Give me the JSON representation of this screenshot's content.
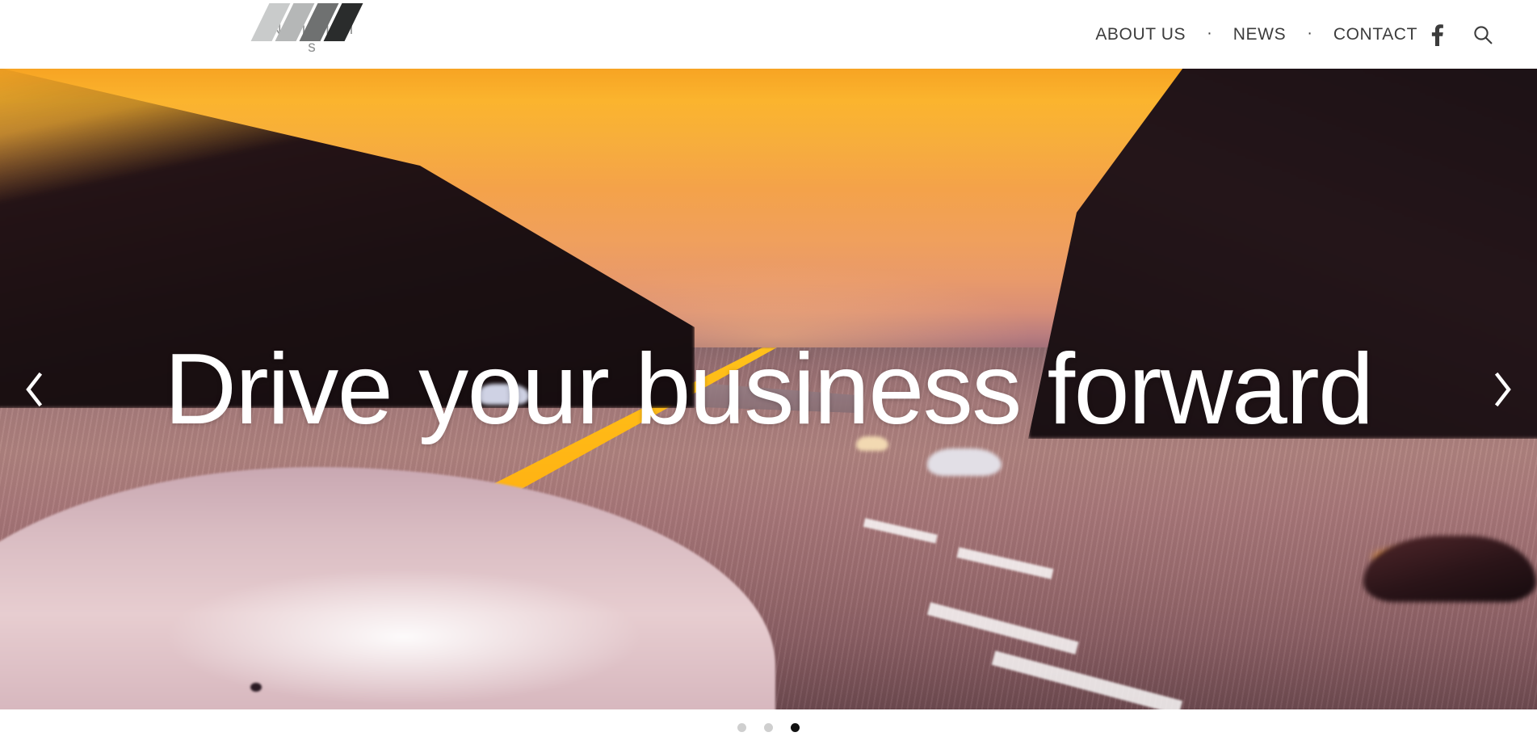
{
  "brand": {
    "wordmark": "Niils",
    "wordmark_spaced": "N i i l s",
    "mark_icon": "four-slashes-logo-icon",
    "mark_colors": [
      "#c9cbcb",
      "#b5b7b7",
      "#6f7171",
      "#2a2c2c"
    ],
    "word_color": "#8f9191"
  },
  "nav": {
    "items": [
      {
        "label": "ABOUT US"
      },
      {
        "label": "NEWS"
      },
      {
        "label": "CONTACT"
      }
    ],
    "separator": "·",
    "social": {
      "name": "facebook",
      "glyph": "f"
    },
    "search": {
      "icon": "search-icon",
      "label": "Search"
    },
    "text_color": "#3c3c3c"
  },
  "hero": {
    "headline": "Drive your business forward",
    "headline_color": "#ffffff",
    "prev_label": "‹",
    "next_label": "›",
    "prev_icon": "chevron-left-icon",
    "next_icon": "chevron-right-icon",
    "image_alt": "Motion-blurred highway at sunset seen from a moving car",
    "palette": {
      "sky_top": "#f7a423",
      "sky_mid": "#f0a05c",
      "road": "#a87c7c",
      "center_line": "#ffc11a",
      "hood": "#e7cdd0",
      "dark_trees": "#1b1012"
    }
  },
  "carousel": {
    "slide_count": 3,
    "active_index": 3,
    "dots": [
      {
        "label": "1",
        "active": false
      },
      {
        "label": "2",
        "active": false
      },
      {
        "label": "3",
        "active": true
      }
    ],
    "dot_inactive_color": "#cfcfcf",
    "dot_active_color": "#111111"
  }
}
